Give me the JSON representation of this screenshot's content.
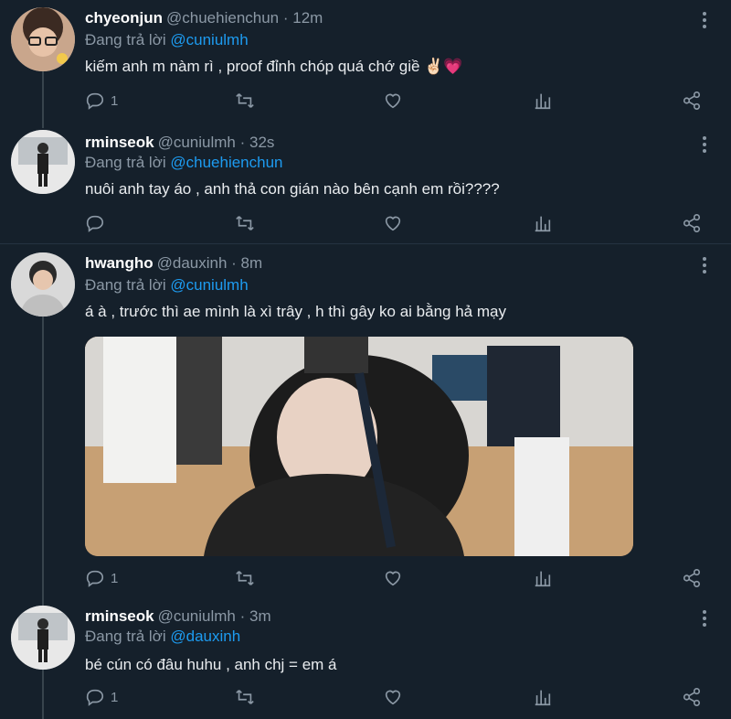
{
  "tweets": [
    {
      "name": "chyeonjun",
      "handle": "@chuehienchun · 12m",
      "reply_prefix": "Đang trả lời",
      "reply_to": "@cuniulmh",
      "text": "kiếm anh m nàm rì , proof đỉnh chóp quá chớ giề ✌🏻💗",
      "replies": "1"
    },
    {
      "name": "rminseok",
      "handle": "@cuniulmh · 32s",
      "reply_prefix": "Đang trả lời",
      "reply_to": "@chuehienchun",
      "text": "nuôi anh tay áo , anh thả con gián nào bên cạnh em rồi????",
      "replies": ""
    },
    {
      "name": "hwangho",
      "handle": "@dauxinh · 8m",
      "reply_prefix": "Đang trả lời",
      "reply_to": "@cuniulmh",
      "text": "á à , trước thì ae mình là xì trây , h thì gây ko ai bằng hả mạy",
      "replies": "1"
    },
    {
      "name": "rminseok",
      "handle": "@cuniulmh · 3m",
      "reply_prefix": "Đang trả lời",
      "reply_to": "@dauxinh",
      "text": "bé cún có đâu huhu , anh chj = em á",
      "replies": "1"
    }
  ],
  "icons": {
    "reply": "reply-icon",
    "retweet": "retweet-icon",
    "like": "heart-icon",
    "stats": "stats-icon",
    "share": "share-icon",
    "more": "more-icon"
  },
  "colors": {
    "background": "#15202b",
    "mention": "#1d9bf0",
    "secondary_text": "#8b98a5"
  }
}
